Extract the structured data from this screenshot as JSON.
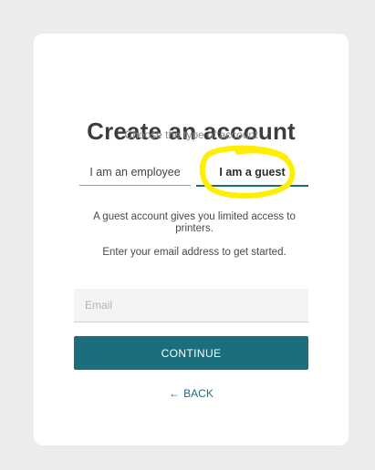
{
  "card": {
    "title": "Create an account",
    "subtitle": "Choose the type of account",
    "tabs": [
      {
        "label": "I am an employee",
        "selected": false
      },
      {
        "label": "I am a guest",
        "selected": true
      }
    ],
    "info": "A guest account gives you limited access to printers.",
    "enter_prompt": "Enter your email address to get started.",
    "email": {
      "placeholder": "Email",
      "value": ""
    },
    "continue_label": "CONTINUE",
    "back_label": "BACK",
    "back_icon": "left-arrow-icon"
  },
  "colors": {
    "accent": "#1b6f7c",
    "highlight": "#ffee00",
    "background": "#ececec",
    "card": "#ffffff"
  }
}
